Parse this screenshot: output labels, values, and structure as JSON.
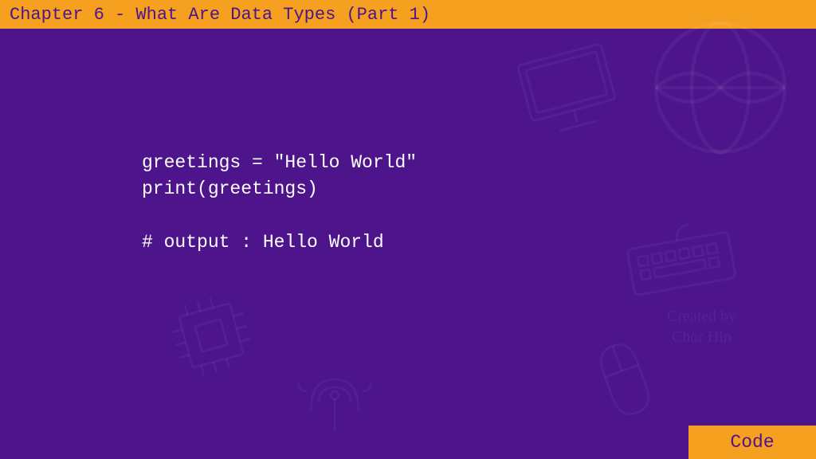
{
  "header": {
    "title": "Chapter 6 - What Are Data Types (Part 1)"
  },
  "code": {
    "line1": "greetings = \"Hello World\"",
    "line2": "print(greetings)",
    "line3": "",
    "line4": "# output : Hello World"
  },
  "footer": {
    "label": "Code"
  },
  "watermark": {
    "line1": "Created by",
    "line2": "Chor Hin"
  },
  "colors": {
    "accent": "#f5a01e",
    "background": "#4d148c",
    "text_light": "#ffffff",
    "text_dark": "#4d148c"
  }
}
